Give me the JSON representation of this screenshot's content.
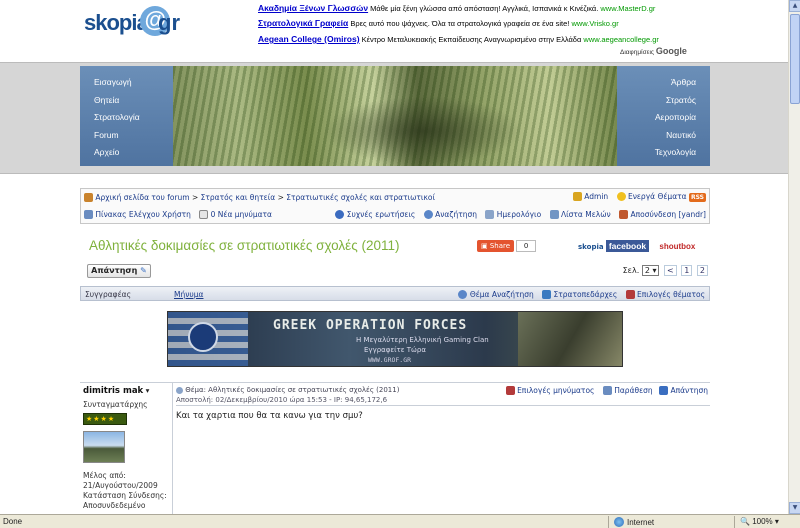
{
  "header": {
    "logo": {
      "part1": "skopia",
      "at": "@",
      "part2": "gr"
    },
    "ads": [
      {
        "title": "Ακαδημία Ξένων Γλωσσών",
        "text": "Μάθε μία ξένη γλώσσα από απόσταση! Αγγλικά, Ισπανικά κ Κινέζικά.",
        "url": "www.MasterD.gr"
      },
      {
        "title": "Στρατολογικά Γραφεία",
        "text": "Βρες αυτό που ψάχνεις. Όλα τα στρατολογικά γραφεία σε ένα site!",
        "url": "www.Vrisko.gr"
      },
      {
        "title": "Aegean College (Omiros)",
        "text": "Κέντρο Μεταλυκειακής Εκπαίδευσης Αναγνωρισμένο στην Ελλάδα",
        "url": "www.aegeancollege.gr"
      }
    ],
    "ads_by": "Διαφημίσεις",
    "ads_by_brand": "Google"
  },
  "nav_left": [
    "Εισαγωγή",
    "Θητεία",
    "Στρατολογία",
    "Forum",
    "Αρχείο"
  ],
  "nav_right": [
    "Άρθρα",
    "Στρατός",
    "Αεροπορία",
    "Ναυτικό",
    "Τεχνολογία"
  ],
  "forumnav": {
    "breadcrumb": [
      "Αρχική σελίδα του forum",
      "Στρατός και θητεία",
      "Στρατιωτικές σχολές και στρατιωτικοί"
    ],
    "admin": "Admin",
    "active_topics": "Ενεργά Θέματα",
    "rss": "RSS",
    "control_panel": "Πίνακας Ελέγχου Χρήστη",
    "new_messages": "0 Νέα μηνύματα",
    "faq": "Συχνές ερωτήσεις",
    "search": "Αναζήτηση",
    "calendar": "Ημερολόγιο",
    "members": "Λίστα Μελών",
    "logout": "Αποσύνδεση [yandr]"
  },
  "topic": {
    "title": "Αθλητικές δοκιμασίες σε στρατιωτικές σχολές (2011)",
    "share_label": "Share",
    "share_count": "0",
    "skopia_tag": "skopia",
    "facebook": "facebook",
    "shoutbox": "shoutbox",
    "reply_button": "Απάντηση",
    "page_label": "Σελ.",
    "page_select": "2",
    "pages": [
      "1",
      "2"
    ],
    "prev_arrow": "<"
  },
  "posts_header": {
    "author": "Συγγραφέας",
    "message": "Μήνυμα",
    "topic_search": "Θέμα Αναζήτηση",
    "camps": "Στρατοπεδάρχες",
    "topic_options": "Επιλογές θέματος"
  },
  "banner_ad": {
    "title": "GREEK OPERATION FORCES",
    "line1": "Η Μεγαλύτερη Ελληνική Gaming Clan",
    "line2": "Εγγραφείτε Τώρα",
    "url": "WWW.GROF.GR"
  },
  "post": {
    "author_name": "dimitris mak",
    "author_rank": "Συνταγματάρχης",
    "joined_label": "Μέλος από:",
    "joined_date": "21/Αυγούστου/2009",
    "status_label": "Κατάσταση Σύνδεσης:",
    "status_value": "Αποσυνδεδεμένο",
    "subject": "Θέμα: Αθλητικές δοκιμασίες σε στρατιωτικές σχολές (2011)",
    "meta": "Αποστολή: 02/Δεκεμβρίου/2010 ώρα 15:53 - IP: 94,65,172,6",
    "message_options": "Επιλογές μηνύματος",
    "quote": "Παράθεση",
    "reply": "Απάντηση",
    "body": "Και τα χαρτια που θα τα κανω για την σμυ?"
  },
  "statusbar": {
    "left": "Done",
    "zone": "Internet",
    "zoom": "100%"
  },
  "colors": {
    "title_green": "#7fb13c",
    "nav_blue": "#5a7eab",
    "link_blue": "#1a3a8a",
    "facebook": "#3b5998"
  }
}
